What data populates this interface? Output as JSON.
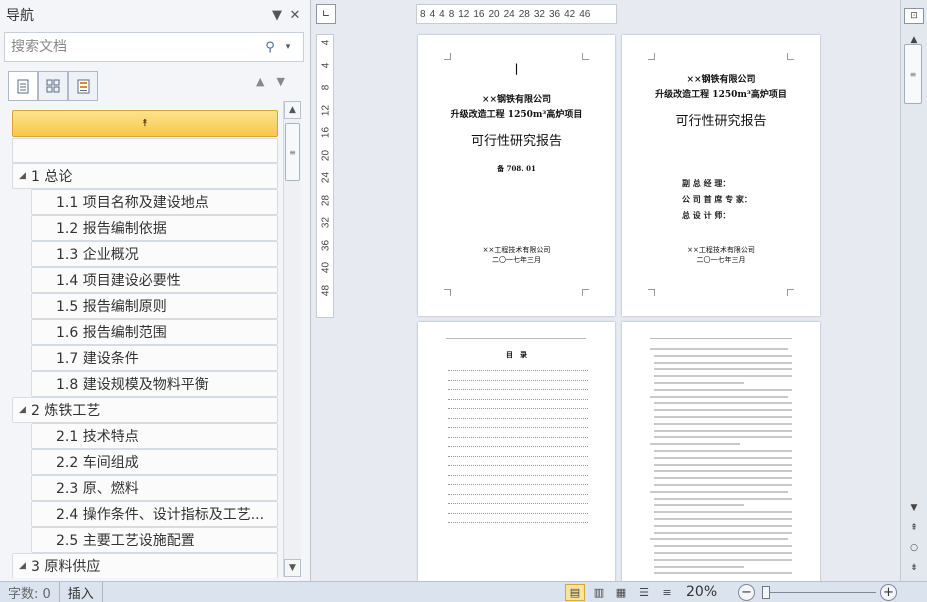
{
  "nav": {
    "title": "导航",
    "search_placeholder": "搜索文档",
    "tree": [
      {
        "level": 1,
        "label": "1 总论"
      },
      {
        "level": 2,
        "label": "1.1 项目名称及建设地点"
      },
      {
        "level": 2,
        "label": "1.2 报告编制依据"
      },
      {
        "level": 2,
        "label": "1.3 企业概况"
      },
      {
        "level": 2,
        "label": "1.4 项目建设必要性"
      },
      {
        "level": 2,
        "label": "1.5 报告编制原则"
      },
      {
        "level": 2,
        "label": "1.6 报告编制范围"
      },
      {
        "level": 2,
        "label": "1.7 建设条件"
      },
      {
        "level": 2,
        "label": "1.8 建设规模及物料平衡"
      },
      {
        "level": 1,
        "label": "2 炼铁工艺"
      },
      {
        "level": 2,
        "label": "2.1 技术特点"
      },
      {
        "level": 2,
        "label": "2.2 车间组成"
      },
      {
        "level": 2,
        "label": "2.3 原、燃料"
      },
      {
        "level": 2,
        "label": "2.4 操作条件、设计指标及工艺..."
      },
      {
        "level": 2,
        "label": "2.5 主要工艺设施配置"
      },
      {
        "level": 1,
        "label": "3 原料供应"
      }
    ]
  },
  "ruler": {
    "horizontal": [
      "8",
      "4",
      "4",
      "8",
      "12",
      "16",
      "20",
      "24",
      "28",
      "32",
      "36",
      "42",
      "46"
    ],
    "vertical": [
      "4",
      "4",
      "8",
      "12",
      "16",
      "20",
      "24",
      "28",
      "32",
      "36",
      "40",
      "48"
    ]
  },
  "pages": {
    "p1": {
      "company": "××钢铁有限公司",
      "project": "升级改造工程 1250m³高炉项目",
      "title": "可行性研究报告",
      "number": "备 708. 01",
      "issuer": "××工程技术有限公司",
      "date": "二〇一七年三月"
    },
    "p2": {
      "company": "××钢铁有限公司",
      "project": "升级改造工程 1250m³高炉项目",
      "title": "可行性研究报告",
      "sign1": "副 总 经 理：",
      "sign2": "公 司 首 席 专 家：",
      "sign3": "总 设 计 师：",
      "issuer": "××工程技术有限公司",
      "date": "二〇一七年三月"
    },
    "p3": {
      "heading": "目　录"
    }
  },
  "status": {
    "word_count": "字数: 0",
    "insert_mode": "插入",
    "zoom": "20%"
  }
}
